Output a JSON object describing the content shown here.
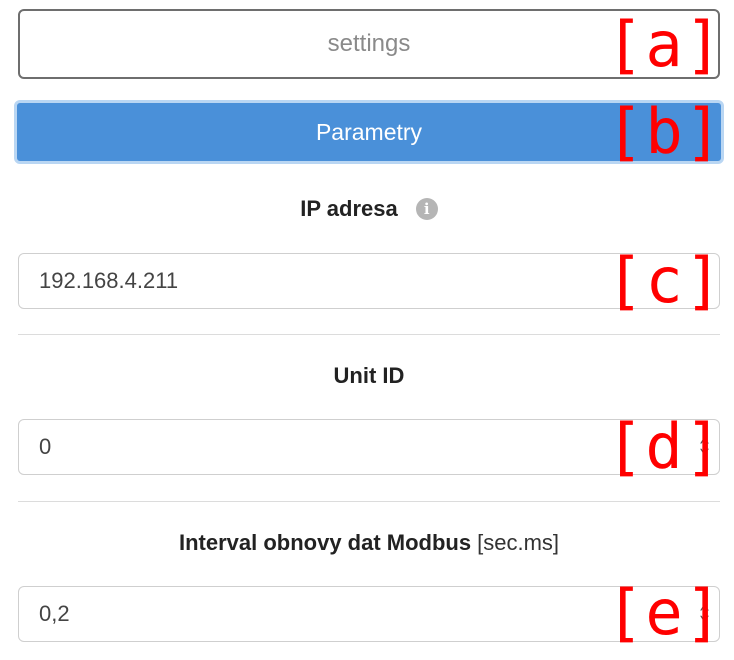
{
  "settings_button": {
    "label": "settings"
  },
  "parameters_button": {
    "label": "Parametry"
  },
  "ip_address": {
    "label": "IP adresa",
    "info_icon": "i",
    "value": "192.168.4.211"
  },
  "unit_id": {
    "label": "Unit ID",
    "value": "0"
  },
  "refresh_interval": {
    "label": "Interval obnovy dat Modbus",
    "unit": "[sec.ms]",
    "value": "0,2"
  },
  "markers": {
    "a": "[a]",
    "b": "[b]",
    "c": "[c]",
    "d": "[d]",
    "e": "[e]"
  },
  "colors": {
    "primary": "#4a90d9",
    "marker": "#ff0000",
    "border": "#cfcfcf"
  }
}
